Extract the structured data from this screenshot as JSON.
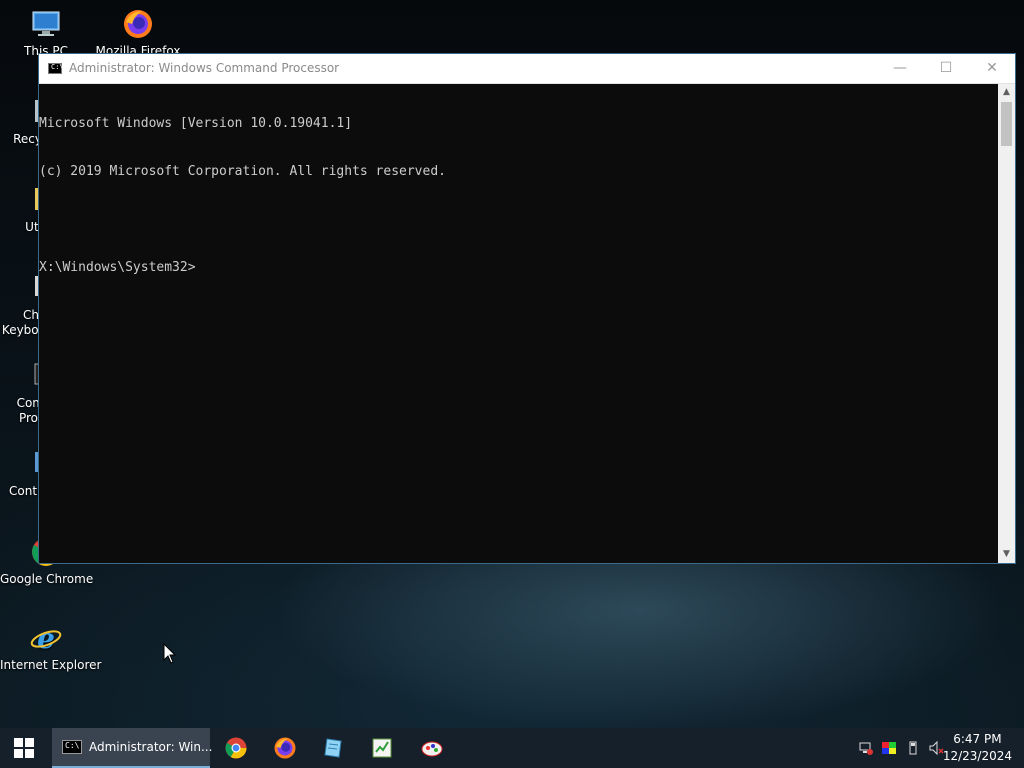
{
  "desktop": {
    "icons": [
      {
        "label": "This PC"
      },
      {
        "label": "Mozilla Firefox"
      },
      {
        "label": "Recy"
      },
      {
        "label": "Uti"
      },
      {
        "label": "Ch"
      },
      {
        "label": "Keyboa"
      },
      {
        "label": "Com"
      },
      {
        "label": "Pro"
      },
      {
        "label": "Contr"
      },
      {
        "label": "Google Chrome"
      },
      {
        "label": "Internet Explorer"
      }
    ]
  },
  "window": {
    "title": "Administrator: Windows Command Processor",
    "icon_text": "C:\\",
    "controls": {
      "minimize": "—",
      "maximize": "☐",
      "close": "✕"
    },
    "lines": [
      "Microsoft Windows [Version 10.0.19041.1]",
      "(c) 2019 Microsoft Corporation. All rights reserved.",
      "",
      "X:\\Windows\\System32>"
    ],
    "scroll_up": "▲",
    "scroll_down": "▼"
  },
  "taskbar": {
    "active_app_label": "Administrator: Win...",
    "active_app_icon_text": "C:\\",
    "pinned": [
      "google-chrome",
      "mozilla-firefox",
      "notepad",
      "spreadsheet",
      "paint"
    ],
    "clock": {
      "time": "6:47 PM",
      "date": "12/23/2024"
    }
  },
  "colors": {
    "console_bg": "#0c0c0c",
    "console_text": "#cccccc",
    "taskbar_bg": "#16202a",
    "active_task_bg": "#3a4450"
  }
}
